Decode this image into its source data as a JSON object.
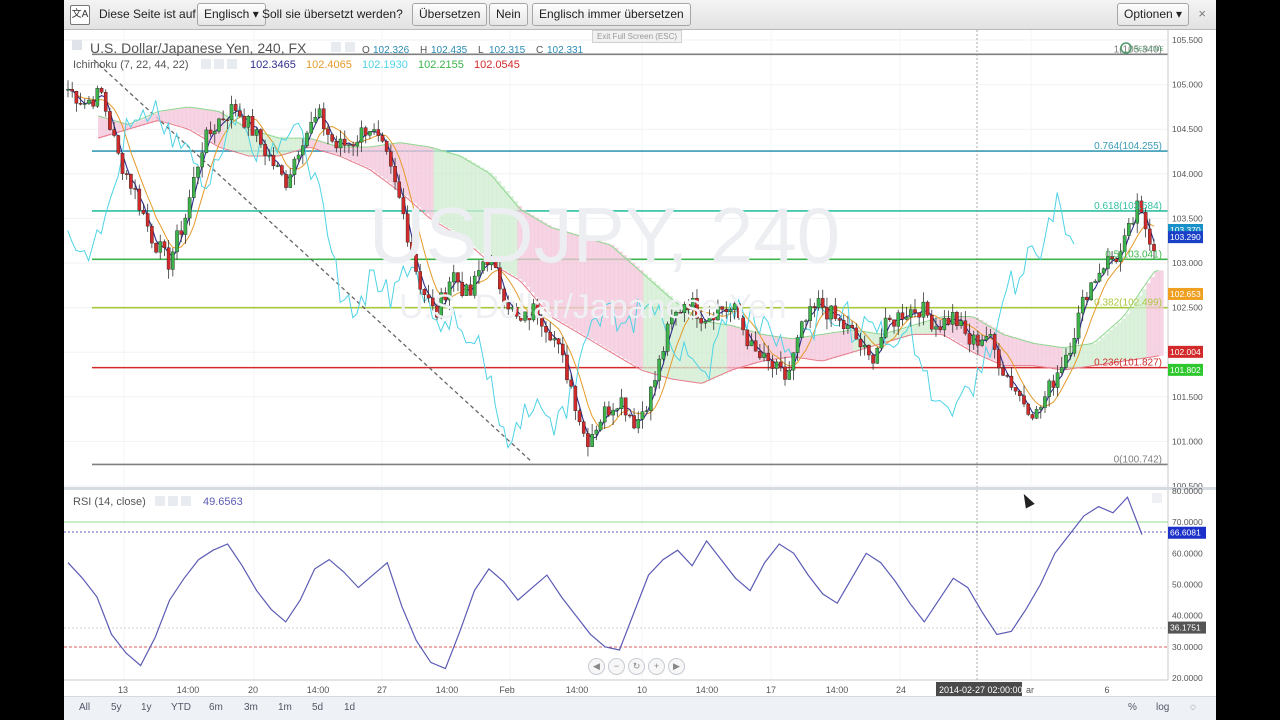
{
  "translate_bar": {
    "icon": "translate-icon",
    "prompt_text": "Diese Seite ist auf",
    "language": "Englisch",
    "question": "Soll sie übersetzt werden?",
    "translate_label": "Übersetzen",
    "no_label": "Nein",
    "always_label": "Englisch immer übersetzen",
    "options_label": "Optionen",
    "close_glyph": "×"
  },
  "exit_fullscreen_text": "Exit Full Screen (ESC)",
  "main_chart": {
    "symbol_title": "U.S. Dollar/Japanese Yen, 240, FX",
    "ohlc": {
      "o_label": "O",
      "o": "102.326",
      "h_label": "H",
      "h": "102.435",
      "l_label": "L",
      "l": "102.315",
      "c_label": "C",
      "c": "102.331"
    },
    "indicator_label": "Ichimoku (7, 22, 44, 22)",
    "indicator_values": [
      {
        "value": "102.3465",
        "color": "#2f2f8f"
      },
      {
        "value": "102.4065",
        "color": "#e69a2a"
      },
      {
        "value": "102.1930",
        "color": "#4fd3e6"
      },
      {
        "value": "102.2155",
        "color": "#3cb44b"
      },
      {
        "value": "102.0545",
        "color": "#d22a2a"
      }
    ],
    "watermark_main": "USDJPY, 240",
    "watermark_sub": "U.S. Dollar/Japanese Yen",
    "realtime_badge": "REALTIME"
  },
  "rsi_panel": {
    "label": "RSI (14, close)",
    "value": "49.6563"
  },
  "time_labels": [
    "13",
    "14:00",
    "20",
    "14:00",
    "27",
    "14:00",
    "Feb",
    "14:00",
    "10",
    "14:00",
    "17",
    "14:00",
    "24",
    "ar",
    "6"
  ],
  "crosshair_time": "2014-02-27 02:00:00",
  "range_buttons": [
    "All",
    "5y",
    "1y",
    "YTD",
    "6m",
    "3m",
    "1m",
    "5d",
    "1d"
  ],
  "right_buttons": {
    "percent": "%",
    "log": "log"
  },
  "colors": {
    "bull": "#3cb44b",
    "bear": "#d22a2a",
    "cloud_bear": "#f3c6da",
    "cloud_bull": "#cfeccf",
    "kijun": "#e69a2a",
    "tenkan": "#2f2f8f",
    "chikou": "#4fd3e6",
    "rsi": "#5b5bb5"
  },
  "chart_data": [
    {
      "type": "candlestick",
      "title": "U.S. Dollar/Japanese Yen, 240, FX",
      "ylim": [
        100.5,
        105.5
      ],
      "y_ticks": [
        "105.500",
        "105.000",
        "104.500",
        "104.000",
        "103.500",
        "103.000",
        "102.500",
        "102.000",
        "101.500",
        "101.000",
        "100.500"
      ],
      "price_badges": [
        {
          "value": "103.370",
          "color": "#1890c8"
        },
        {
          "value": "103.290",
          "color": "#1a40c8"
        },
        {
          "value": "102.653",
          "color": "#f0a020"
        },
        {
          "value": "102.004",
          "color": "#d22a2a"
        },
        {
          "value": "101.802",
          "color": "#2ec82e"
        }
      ],
      "fib_levels": [
        {
          "label": "1(105.340)",
          "value": 105.34,
          "color": "#7f7f7f"
        },
        {
          "label": "0.764(104.255)",
          "value": 104.255,
          "color": "#3a9bb5"
        },
        {
          "label": "0.618(103.584)",
          "value": 103.584,
          "color": "#2fc0a0"
        },
        {
          "label": "0.5(103.041)",
          "value": 103.041,
          "color": "#3cb44b"
        },
        {
          "label": "0.382(102.499)",
          "value": 102.499,
          "color": "#a8c83c"
        },
        {
          "label": "0.236(101.827)",
          "value": 101.827,
          "color": "#d22a2a"
        },
        {
          "label": "0(100.742)",
          "value": 100.742,
          "color": "#7f7f7f"
        }
      ],
      "close_path": [
        104.95,
        104.8,
        104.9,
        104.2,
        103.8,
        103.3,
        103.0,
        103.5,
        104.3,
        104.6,
        104.75,
        104.5,
        104.2,
        103.9,
        104.4,
        104.65,
        104.3,
        104.35,
        104.55,
        104.2,
        103.6,
        102.8,
        102.4,
        102.9,
        102.6,
        103.1,
        102.7,
        102.3,
        102.5,
        102.2,
        101.7,
        101.0,
        101.3,
        101.5,
        101.2,
        101.6,
        102.3,
        102.6,
        102.4,
        102.5,
        102.45,
        102.0,
        101.85,
        101.7,
        102.3,
        102.55,
        102.35,
        102.2,
        101.9,
        102.3,
        102.45,
        102.5,
        102.3,
        102.4,
        102.1,
        102.2,
        101.8,
        101.5,
        101.3,
        101.7,
        102.1,
        102.7,
        103.0,
        103.1,
        103.6,
        103.2
      ],
      "cloud_top_path": [
        104.65,
        104.55,
        104.7,
        104.75,
        104.7,
        104.5,
        104.4,
        104.4,
        104.3,
        104.3,
        104.35,
        104.3,
        104.2,
        104.0,
        103.6,
        103.4,
        103.3,
        103.2,
        102.9,
        102.6,
        102.35,
        102.3,
        102.2,
        102.15,
        102.2,
        102.25,
        102.2,
        102.3,
        102.4,
        102.4,
        102.2,
        102.1,
        102.05,
        102.1,
        102.4,
        102.9,
        103.0
      ],
      "cloud_bottom_path": [
        104.4,
        104.5,
        104.6,
        104.5,
        104.3,
        104.2,
        104.2,
        104.3,
        104.2,
        104.05,
        103.8,
        103.5,
        103.3,
        103.0,
        102.8,
        102.4,
        102.2,
        102.0,
        101.8,
        101.7,
        101.65,
        101.8,
        101.9,
        101.95,
        101.9,
        102.0,
        102.1,
        102.2,
        102.2,
        102.0,
        101.85,
        101.85,
        101.8,
        101.85,
        101.9,
        101.95,
        102.0
      ]
    },
    {
      "type": "line",
      "title": "RSI (14, close)",
      "ylim": [
        20,
        80
      ],
      "y_ticks": [
        "80.0000",
        "70.0000",
        "60.0000",
        "50.0000",
        "40.0000",
        "30.0000",
        "20.0000"
      ],
      "current_badge": {
        "value": "66.6081",
        "color": "#1a30c8"
      },
      "low_badge": {
        "value": "36.1751",
        "color": "#555555"
      },
      "overbought": 70,
      "oversold": 30,
      "values": [
        57,
        52,
        46,
        34,
        28,
        24,
        33,
        45,
        52,
        58,
        61,
        63,
        56,
        48,
        42,
        38,
        45,
        55,
        58,
        54,
        49,
        53,
        57,
        43,
        32,
        25,
        23,
        35,
        48,
        55,
        51,
        45,
        49,
        53,
        46,
        40,
        34,
        30,
        29,
        41,
        53,
        58,
        61,
        56,
        64,
        58,
        52,
        48,
        57,
        63,
        60,
        53,
        47,
        44,
        52,
        60,
        57,
        51,
        44,
        38,
        45,
        52,
        49,
        41,
        34,
        35,
        42,
        50,
        60,
        66,
        72,
        75,
        73,
        78,
        66
      ]
    }
  ]
}
